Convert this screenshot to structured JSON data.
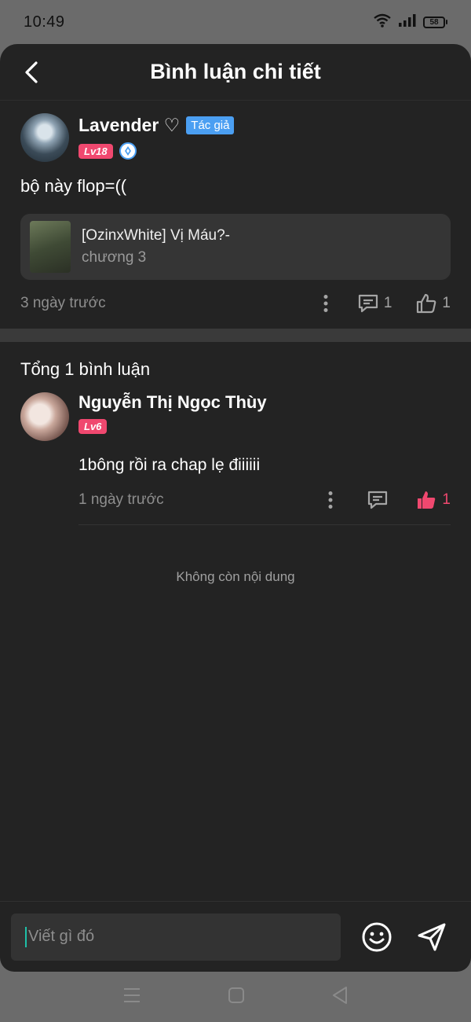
{
  "status_bar": {
    "time": "10:49",
    "battery": "58"
  },
  "header": {
    "title": "Bình luận chi tiết"
  },
  "post": {
    "author_name": "Lavender ♡",
    "author_badge": "Tác giả",
    "level": "Lv18",
    "text": "bộ này flop=((",
    "story": {
      "title": "[OzinxWhite] Vị Máu?-",
      "chapter": "chương 3"
    },
    "time": "3 ngày trước",
    "comment_count": "1",
    "like_count": "1"
  },
  "comments_section": {
    "total_label": "Tổng 1 bình luận",
    "items": [
      {
        "name": "Nguyễn Thị Ngọc Thùy",
        "level": "Lv6",
        "text": "1bông rồi ra chap lẹ điiiiii",
        "time": "1 ngày trước",
        "like_count": "1",
        "liked": true
      }
    ],
    "end_note": "Không còn nội dung"
  },
  "input": {
    "placeholder": "Viết gì đó"
  },
  "colors": {
    "sheet_bg": "#232323",
    "accent_pink": "#f0486f",
    "author_badge_blue": "#4b9ff2"
  }
}
